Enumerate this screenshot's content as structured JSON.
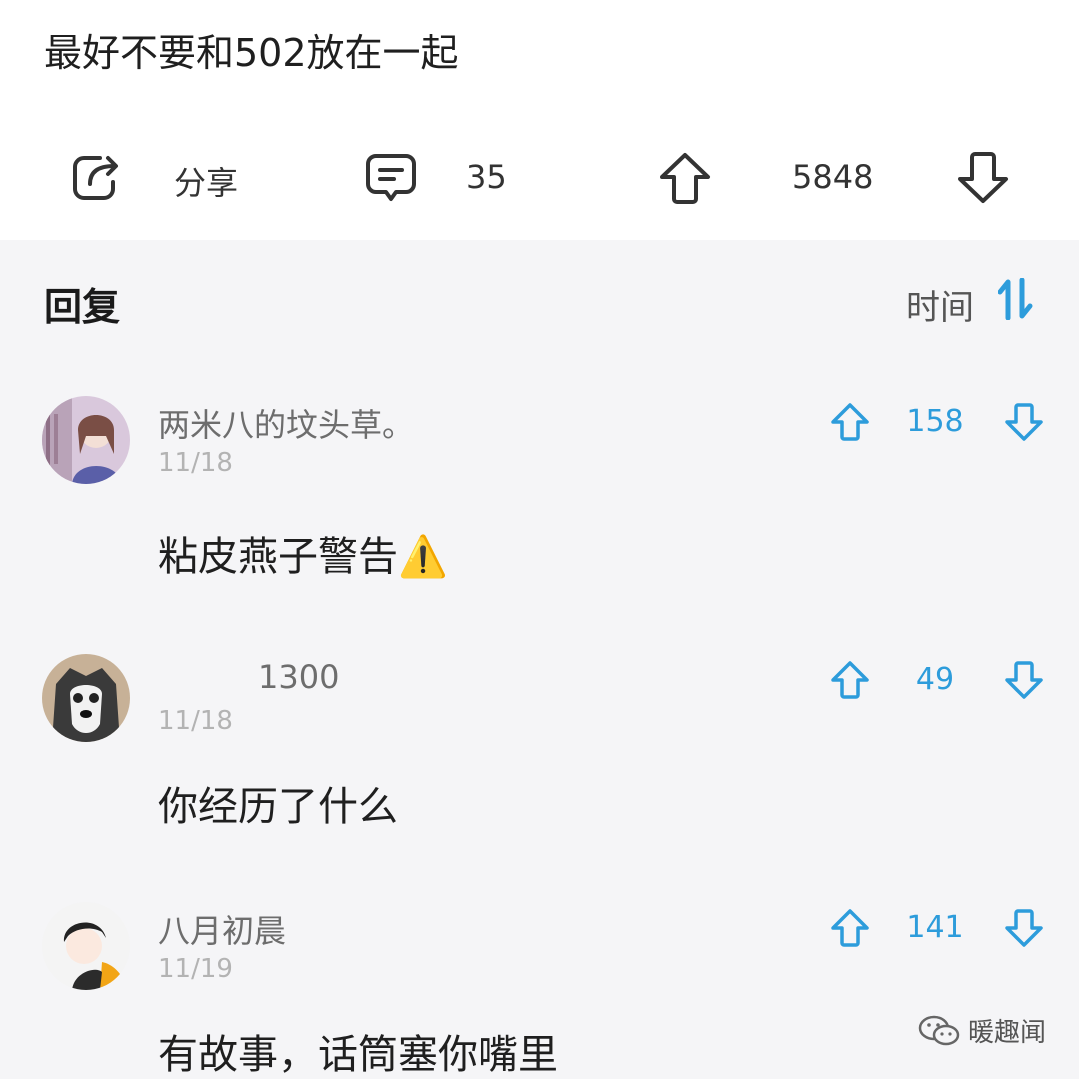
{
  "post": {
    "text": "最好不要和502放在一起"
  },
  "actions": {
    "share_label": "分享",
    "comment_count": "35",
    "upvote_count": "5848"
  },
  "replies": {
    "title": "回复",
    "sort_label": "时间"
  },
  "comments": [
    {
      "username": "两米八的坟头草。",
      "date": "11/18",
      "text": "粘皮燕子警告⚠️",
      "votes": "158"
    },
    {
      "username": "1300",
      "date": "11/18",
      "text": "你经历了什么",
      "votes": "49"
    },
    {
      "username": "八月初晨",
      "date": "11/19",
      "text": "有故事，话筒塞你嘴里",
      "votes": "141"
    }
  ],
  "watermark": {
    "text": "暖趣闻"
  },
  "colors": {
    "accent": "#2d9cdb",
    "background": "#f5f5f7"
  }
}
